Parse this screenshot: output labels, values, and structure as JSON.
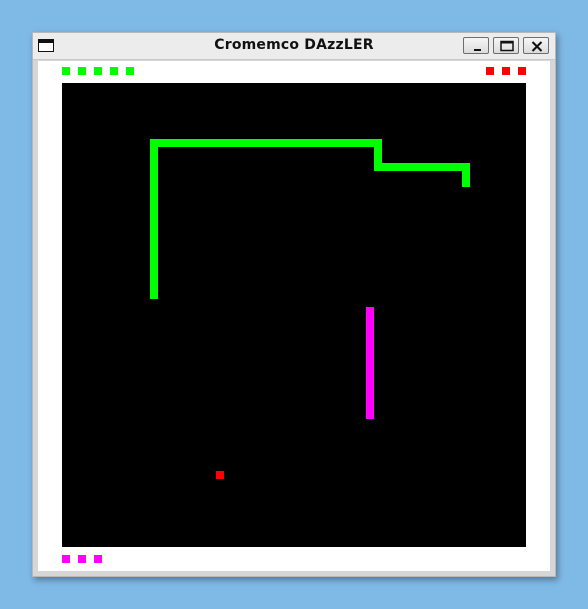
{
  "window": {
    "title": "Cromemco DAzzLER"
  },
  "game": {
    "player1_color": "#00ff00",
    "player2_color": "#ff00ff",
    "food_color": "#ff0000",
    "background_color": "#000000",
    "player1_lives": 5,
    "enemy_lives_top_right": 3,
    "player2_lives": 3
  },
  "icons": {
    "system_menu": "window-icon",
    "minimize": "minimize-icon",
    "maximize": "maximize-icon",
    "close": "close-icon"
  }
}
